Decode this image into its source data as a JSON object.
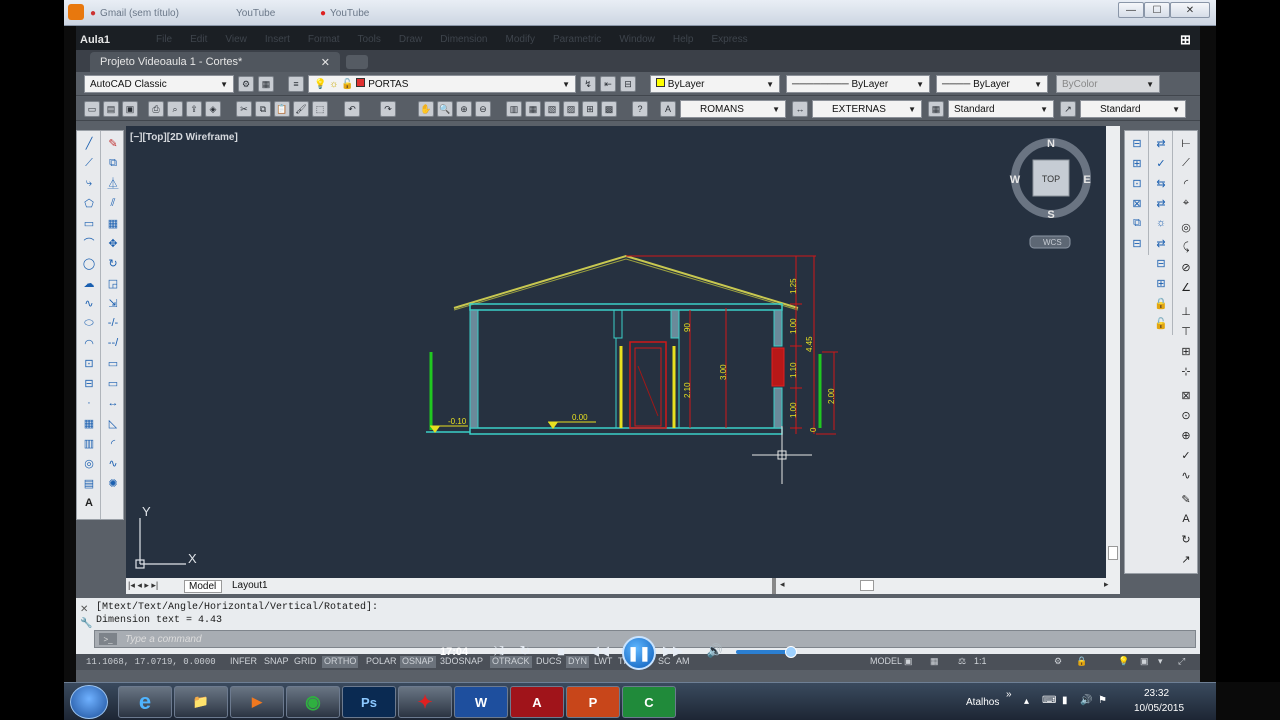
{
  "player": {
    "tabs": [
      "Gmail (sem título)",
      "YouTube",
      "YouTube"
    ],
    "window_buttons": {
      "minimize": "—",
      "maximize": "☐",
      "close": "✕"
    }
  },
  "app": {
    "title": "Aula1",
    "menus": [
      "File",
      "Edit",
      "View",
      "Insert",
      "Format",
      "Tools",
      "Draw",
      "Dimension",
      "Modify",
      "Parametric",
      "Window",
      "Help",
      "Express"
    ],
    "doc_tab": "Projeto Videoaula 1 - Cortes*",
    "doc_tab_close": "✕"
  },
  "toolbar1": {
    "workspace": "AutoCAD Classic",
    "layer": "PORTAS",
    "color": "ByLayer",
    "linetype": "ByLayer",
    "lineweight": "ByLayer",
    "plotstyle": "ByColor"
  },
  "toolbar2": {
    "text_style": "ROMANS",
    "dim_style": "EXTERNAS",
    "table_style": "Standard",
    "mleader_style": "Standard"
  },
  "viewport": {
    "label": "[−][Top][2D Wireframe]",
    "compass": {
      "n": "N",
      "s": "S",
      "e": "E",
      "w": "W",
      "top": "TOP",
      "wcs": "WCS"
    },
    "ucs": {
      "x": "X",
      "y": "Y"
    },
    "dimensions": {
      "d1": "1.25",
      "d2": "1.00",
      "d3": "1.10",
      "d4": "1.00",
      "d5": "4.45",
      "d6": "2.00",
      "d7": "3.00",
      "d8": "2.10",
      "d9": "90",
      "d10": "0",
      "level1": "-0.10",
      "level2": "0.00"
    }
  },
  "layout_tabs": {
    "model": "Model",
    "layout1": "Layout1"
  },
  "command": {
    "line1": "[Mtext/Text/Angle/Horizontal/Vertical/Rotated]:",
    "line2": "Dimension text = 4.43",
    "placeholder": "Type a command"
  },
  "status": {
    "coords": "11.1068, 17.0719, 0.0000",
    "toggles": [
      "INFER",
      "SNAP",
      "GRID",
      "ORTHO",
      "POLAR",
      "OSNAP",
      "3DOSNAP",
      "OTRACK",
      "DUCS",
      "DYN",
      "LWT",
      "TPY",
      "QP",
      "SC",
      "AM"
    ],
    "model": "MODEL",
    "scale": "1:1"
  },
  "media": {
    "time": "17:04"
  },
  "taskbar": {
    "items": [
      "e",
      "📁",
      "▶",
      "◉",
      "Ps",
      "✦",
      "W",
      "A",
      "P",
      "C"
    ],
    "tray_label": "Atalhos",
    "time": "23:32",
    "date": "10/05/2015"
  },
  "colors": {
    "viewport_bg": "#263140",
    "roof": "#c8c850",
    "wall": "#3ad0c8",
    "door": "#e8e020",
    "dims": "#d01818",
    "green": "#20c820"
  }
}
